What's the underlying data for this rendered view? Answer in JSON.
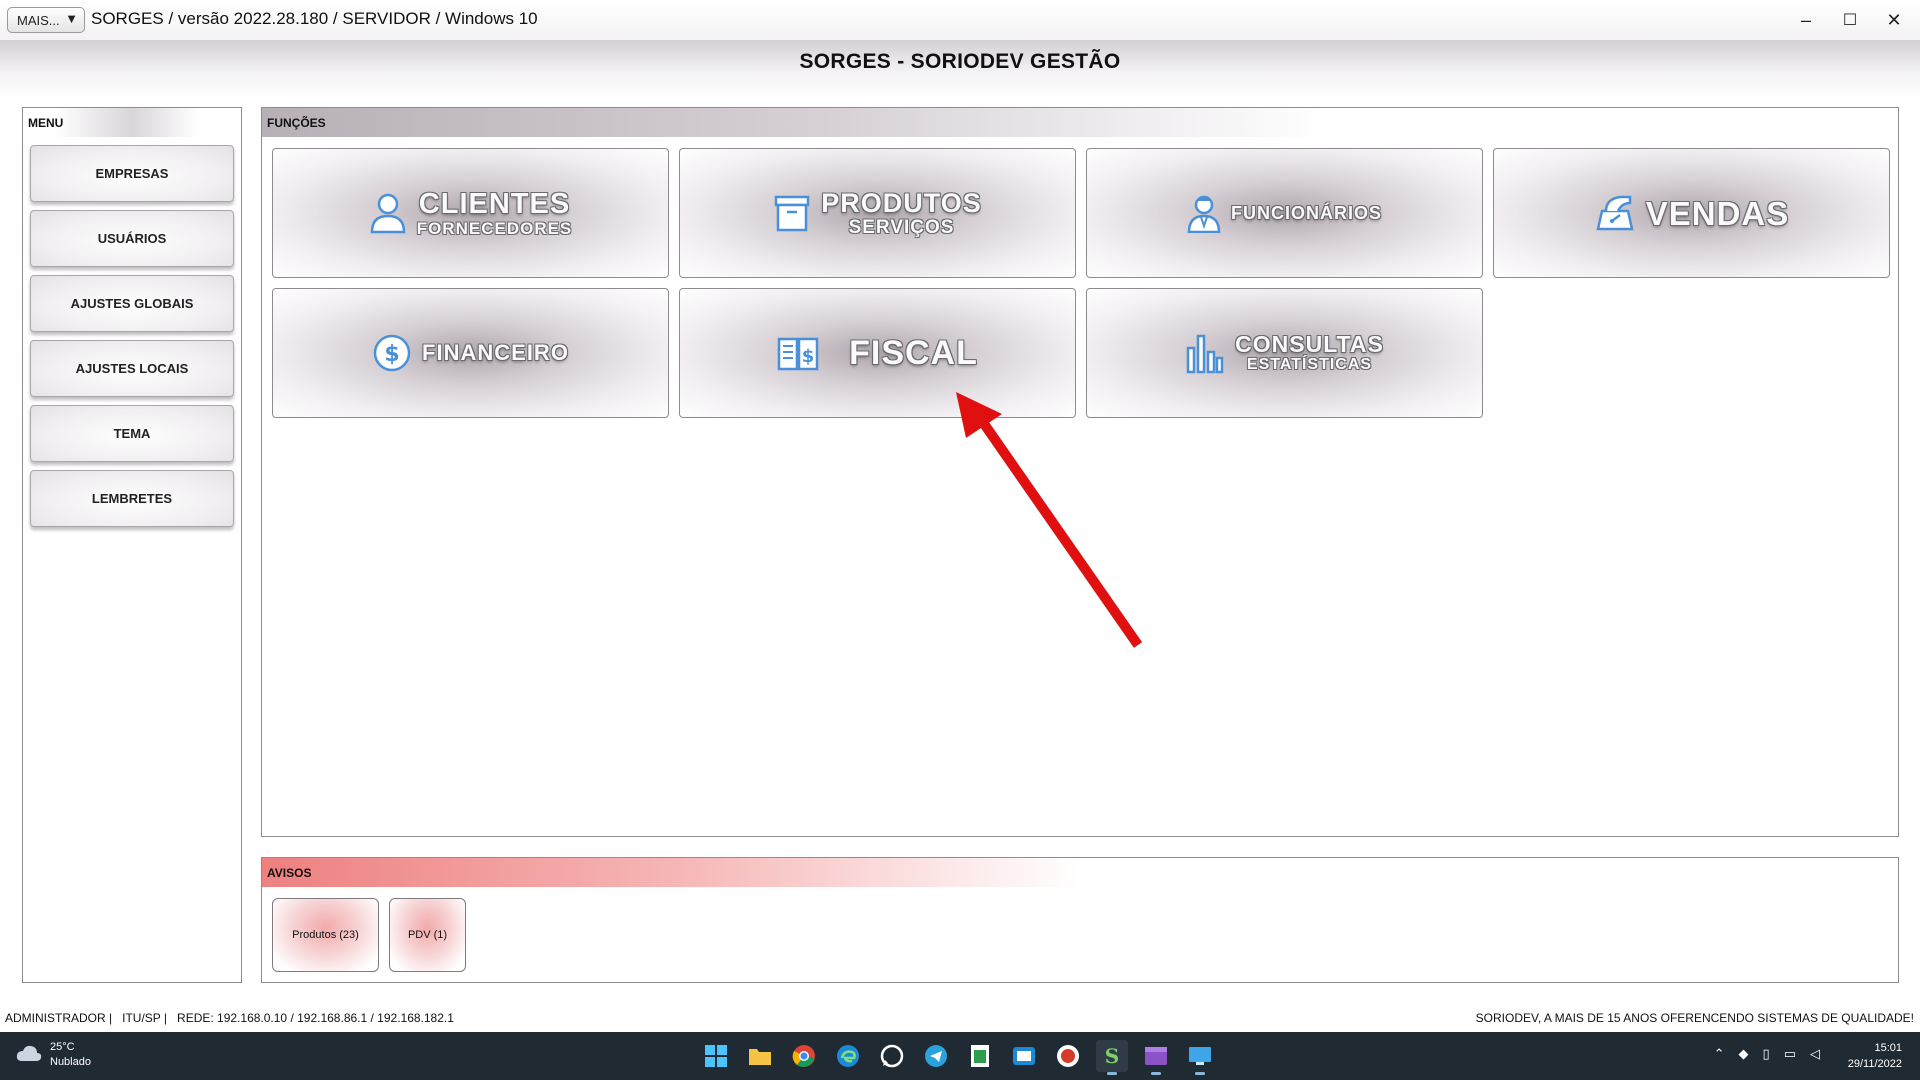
{
  "window": {
    "mais_button": "MAIS...",
    "mais_arrow": "▼",
    "version_text": "SORGES / versão 2022.28.180 / SERVIDOR / Windows 10",
    "minimize": "–",
    "maximize": "☐",
    "close": "✕"
  },
  "header": {
    "title": "SORGES - SORIODEV GESTÃO"
  },
  "menu": {
    "title": "MENU",
    "items": [
      {
        "label": "EMPRESAS"
      },
      {
        "label": "USUÁRIOS"
      },
      {
        "label": "AJUSTES GLOBAIS"
      },
      {
        "label": "AJUSTES LOCAIS"
      },
      {
        "label": "TEMA"
      },
      {
        "label": "LEMBRETES"
      }
    ]
  },
  "functions": {
    "title": "FUNÇÕES",
    "tiles": [
      {
        "main": "CLIENTES",
        "sub": "FORNECEDORES",
        "icon": "person-icon"
      },
      {
        "main": "PRODUTOS",
        "sub": "SERVIÇOS",
        "icon": "box-icon"
      },
      {
        "main": "FUNCIONÁRIOS",
        "sub": "",
        "icon": "employee-icon"
      },
      {
        "main": "VENDAS",
        "sub": "",
        "icon": "scale-icon"
      },
      {
        "main": "FINANCEIRO",
        "sub": "",
        "icon": "dollar-icon"
      },
      {
        "main": "FISCAL",
        "sub": "",
        "icon": "fiscal-book-icon"
      },
      {
        "main": "CONSULTAS",
        "sub": "ESTATÍSTICAS",
        "icon": "bar-chart-icon"
      }
    ]
  },
  "avisos": {
    "title": "AVISOS",
    "items": [
      {
        "label": "Produtos (23)"
      },
      {
        "label": "PDV (1)"
      }
    ]
  },
  "status": {
    "left": "ADMINISTRADOR |   ITU/SP |   REDE: 192.168.0.10 / 192.168.86.1 / 192.168.182.1",
    "right": "SORIODEV, A MAIS DE 15 ANOS OFERENCENDO SISTEMAS DE QUALIDADE!"
  },
  "taskbar": {
    "temperature": "25°C",
    "weather": "Nublado",
    "time": "15:01",
    "date": "29/11/2022",
    "apps": [
      "windows-start-icon",
      "file-explorer-icon",
      "chrome-icon",
      "edge-icon",
      "whatsapp-icon",
      "telegram-icon",
      "spreadsheet-icon",
      "mail-icon",
      "game-icon",
      "sorges-app-icon",
      "media-icon",
      "remote-desktop-icon"
    ]
  },
  "colors": {
    "accent_icon": "#4a90d9",
    "arrow": "#e01010",
    "avisos_header": "#ee8080",
    "taskbar": "#1f2a33"
  }
}
